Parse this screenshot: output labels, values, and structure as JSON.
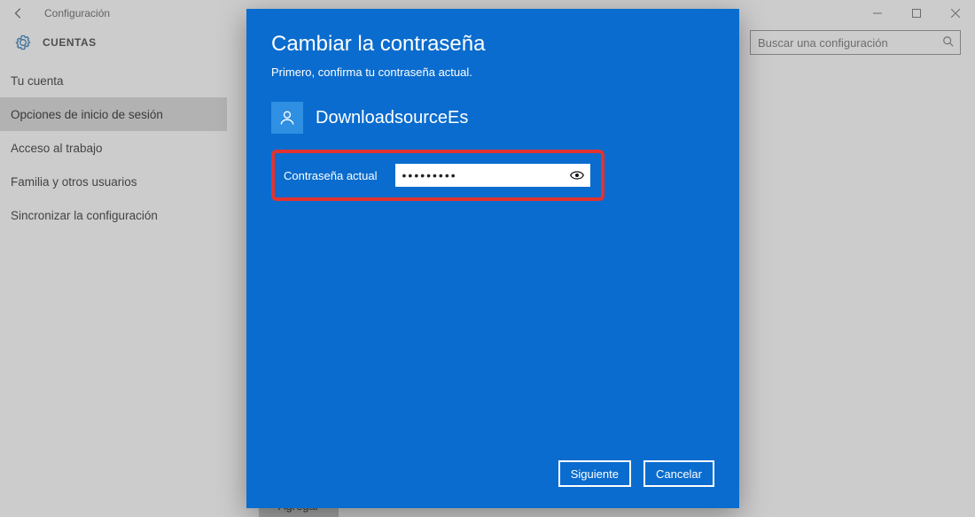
{
  "window": {
    "title": "Configuración",
    "section": "CUENTAS"
  },
  "search": {
    "placeholder": "Buscar una configuración"
  },
  "sidebar": {
    "items": [
      {
        "label": "Tu cuenta"
      },
      {
        "label": "Opciones de inicio de sesión",
        "selected": true
      },
      {
        "label": "Acceso al trabajo"
      },
      {
        "label": "Familia y otros usuarios"
      },
      {
        "label": "Sincronizar la configuración"
      }
    ]
  },
  "content": {
    "button": "Agregar"
  },
  "dialog": {
    "title": "Cambiar la contraseña",
    "subtitle": "Primero, confirma tu contraseña actual.",
    "user": "DownloadsourceEs",
    "pw_label": "Contraseña actual",
    "pw_value": "•••••••••",
    "next": "Siguiente",
    "cancel": "Cancelar"
  }
}
